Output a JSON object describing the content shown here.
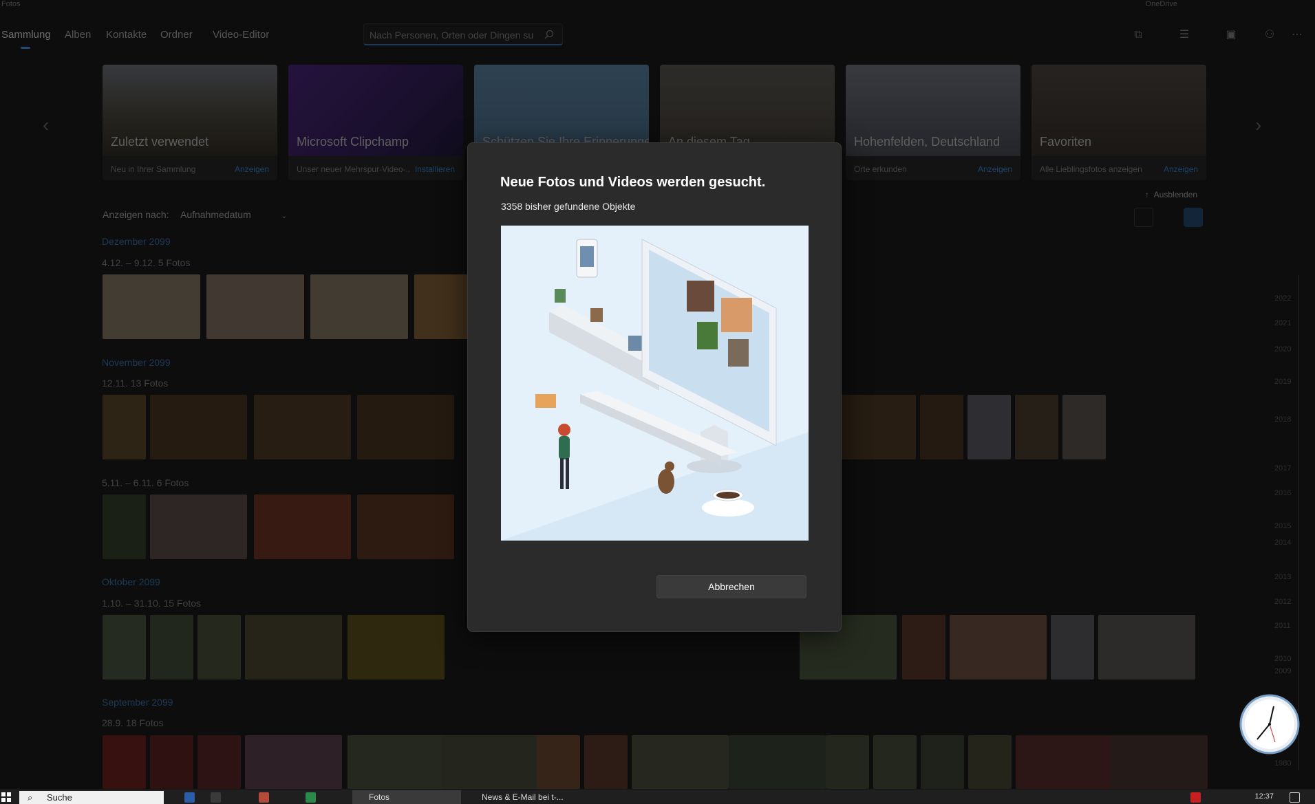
{
  "window": {
    "title": "Fotos",
    "onedrive": "OneDrive"
  },
  "nav": {
    "tabs": [
      "Sammlung",
      "Alben",
      "Kontakte",
      "Ordner",
      "Video-Editor"
    ],
    "active": "Sammlung"
  },
  "search": {
    "placeholder": "Nach Personen, Orten oder Dingen su"
  },
  "cards": [
    {
      "title": "Zuletzt verwendet",
      "subtitle": "Neu in Ihrer Sammlung",
      "action": "Anzeigen"
    },
    {
      "title": "Microsoft Clipchamp",
      "subtitle": "Unser neuer Mehrspur-Video-...",
      "action": "Installieren"
    },
    {
      "title": "Schützen Sie Ihre Erinnerungen",
      "subtitle": "",
      "action": ""
    },
    {
      "title": "An diesem Tag",
      "subtitle": "",
      "action": ""
    },
    {
      "title": "Hohenfelden, Deutschland",
      "subtitle": "Orte erkunden",
      "action": "Anzeigen"
    },
    {
      "title": "Favoriten",
      "subtitle": "Alle Lieblingsfotos anzeigen",
      "action": "Anzeigen"
    }
  ],
  "view": {
    "label": "Anzeigen nach:",
    "selected": "Aufnahmedatum",
    "hide": "Ausblenden"
  },
  "groups": [
    {
      "month": "Dezember 2099",
      "range": "4.12. – 9.12.   5 Fotos"
    },
    {
      "month": "November 2099",
      "range": "12.11.   13 Fotos"
    },
    {
      "month": "",
      "range": "5.11. – 6.11.   6 Fotos"
    },
    {
      "month": "Oktober 2099",
      "range": "1.10. – 31.10.   15 Fotos"
    },
    {
      "month": "September 2099",
      "range": "28.9.   18 Fotos"
    }
  ],
  "timeline": [
    "2022",
    "2021",
    "2020",
    "2019",
    "2018",
    "2017",
    "2016",
    "2015",
    "2014",
    "2013",
    "2012",
    "2011",
    "2010",
    "2009",
    "1980"
  ],
  "dialog": {
    "title": "Neue Fotos und Videos werden gesucht.",
    "count": "3358 bisher gefundene Objekte",
    "cancel": "Abbrechen"
  },
  "taskbar": {
    "search": "Suche",
    "app1": "Fotos",
    "app2": "News & E-Mail bei t-...",
    "time": "12:37"
  },
  "colors": {
    "accent": "#2f6aa8",
    "dialog_bg": "#2b2b2b"
  }
}
